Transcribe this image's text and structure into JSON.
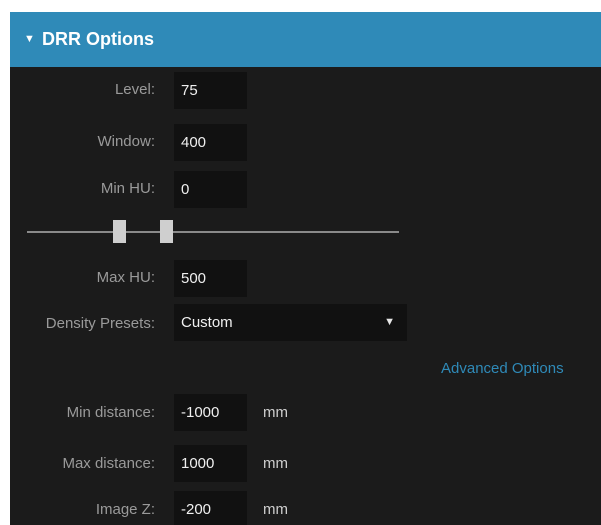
{
  "panel": {
    "title": "DRR Options",
    "collapse_glyph": "▼",
    "collapse_icon": "caret-down-icon",
    "accent_color": "#2f8ab8"
  },
  "fields": {
    "level": {
      "label": "Level:",
      "value": "75"
    },
    "window": {
      "label": "Window:",
      "value": "400"
    },
    "min_hu": {
      "label": "Min HU:",
      "value": "0"
    },
    "max_hu": {
      "label": "Max HU:",
      "value": "500"
    }
  },
  "hu_range_slider": {
    "low_value": 0,
    "high_value": 500
  },
  "density_presets": {
    "label": "Density Presets:",
    "selected": "Custom",
    "arrow_glyph": "▼",
    "arrow_icon": "dropdown-arrow-icon"
  },
  "advanced_options_link": "Advanced Options",
  "distance": {
    "min": {
      "label": "Min distance:",
      "value": "-1000",
      "unit": "mm"
    },
    "max": {
      "label": "Max distance:",
      "value": "1000",
      "unit": "mm"
    }
  },
  "image_z": {
    "label": "Image Z:",
    "value": "-200",
    "unit": "mm"
  }
}
